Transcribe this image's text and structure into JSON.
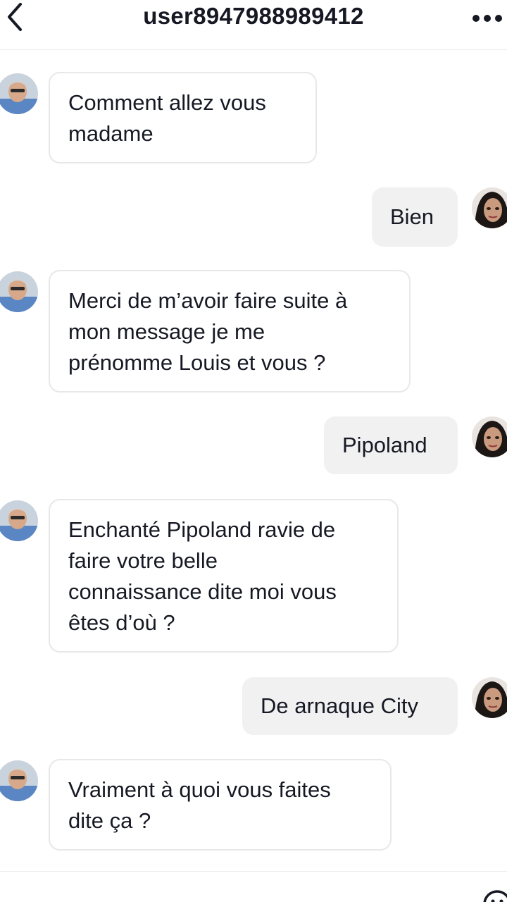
{
  "header": {
    "title": "user8947988989412",
    "back_icon": "chevron-left-icon",
    "more_icon": "more-horizontal-icon"
  },
  "messages": [
    {
      "from": "other",
      "text_lines": [
        "Comment allez vous",
        "madame"
      ]
    },
    {
      "from": "me",
      "text": "Bien"
    },
    {
      "from": "other",
      "text_lines": [
        "Merci de m’avoir faire suite à",
        "mon message je me",
        "prénomme Louis et vous ?"
      ]
    },
    {
      "from": "me",
      "text": "Pipoland"
    },
    {
      "from": "other",
      "text_lines": [
        "Enchanté Pipoland ravie de",
        "faire votre belle",
        "connaissance dite moi vous",
        "êtes d’où ?"
      ]
    },
    {
      "from": "me",
      "text": "De arnaque City"
    },
    {
      "from": "other",
      "text_lines": [
        "Vraiment à quoi vous faites",
        "dite ça ?"
      ]
    }
  ],
  "input": {
    "emoji_icon": "emoji-icon"
  },
  "colors": {
    "text": "#161823",
    "outgoing_bubble": "#f1f1f2",
    "incoming_border": "#e8e8e8"
  }
}
